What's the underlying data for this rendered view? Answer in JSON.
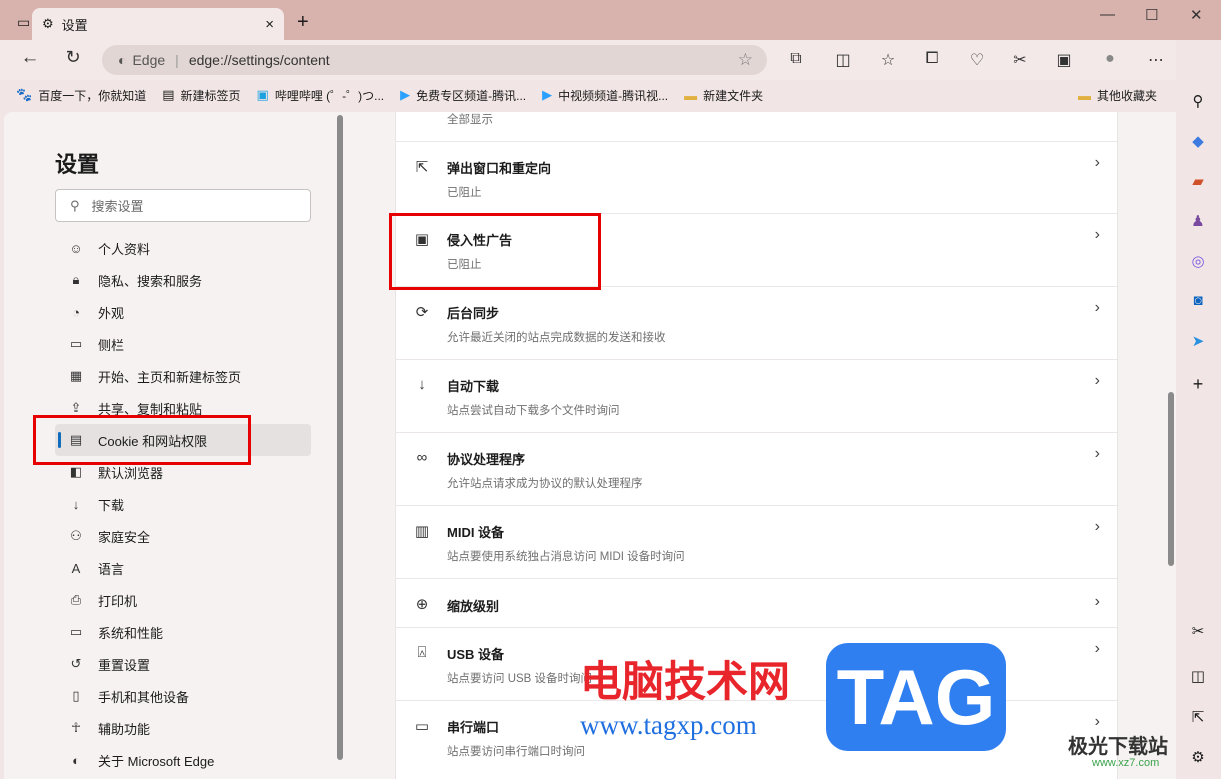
{
  "browser": {
    "tab_title": "设置",
    "address_brand": "Edge",
    "url": "edge://settings/content"
  },
  "bookmarks": [
    {
      "label": "百度一下，你就知道",
      "icon": "baidu-icon"
    },
    {
      "label": "新建标签页",
      "icon": "newtab-icon"
    },
    {
      "label": "哔哩哔哩 (゜-゜)つ...",
      "icon": "bilibili-icon"
    },
    {
      "label": "免费专区频道-腾讯...",
      "icon": "tencent-video-icon"
    },
    {
      "label": "中视频频道-腾讯视...",
      "icon": "tencent-video-icon"
    },
    {
      "label": "新建文件夹",
      "icon": "folder-icon"
    }
  ],
  "other_bookmarks": "其他收藏夹",
  "settings": {
    "title": "设置",
    "search_placeholder": "搜索设置",
    "nav": [
      {
        "label": "个人资料",
        "icon": "profile-icon"
      },
      {
        "label": "隐私、搜索和服务",
        "icon": "lock-icon"
      },
      {
        "label": "外观",
        "icon": "palette-icon"
      },
      {
        "label": "侧栏",
        "icon": "sidebar-icon"
      },
      {
        "label": "开始、主页和新建标签页",
        "icon": "home-icon"
      },
      {
        "label": "共享、复制和粘贴",
        "icon": "share-icon"
      },
      {
        "label": "Cookie 和网站权限",
        "icon": "cookie-icon",
        "active": true
      },
      {
        "label": "默认浏览器",
        "icon": "browser-icon"
      },
      {
        "label": "下载",
        "icon": "download-icon"
      },
      {
        "label": "家庭安全",
        "icon": "family-icon"
      },
      {
        "label": "语言",
        "icon": "language-icon"
      },
      {
        "label": "打印机",
        "icon": "printer-icon"
      },
      {
        "label": "系统和性能",
        "icon": "system-icon"
      },
      {
        "label": "重置设置",
        "icon": "reset-icon"
      },
      {
        "label": "手机和其他设备",
        "icon": "phone-icon"
      },
      {
        "label": "辅助功能",
        "icon": "accessibility-icon"
      },
      {
        "label": "关于 Microsoft Edge",
        "icon": "edge-icon"
      }
    ]
  },
  "content": {
    "partial_row_sub": "全部显示",
    "rows": [
      {
        "title": "弹出窗口和重定向",
        "sub": "已阻止",
        "icon": "popup-icon"
      },
      {
        "title": "侵入性广告",
        "sub": "已阻止",
        "icon": "ads-icon"
      },
      {
        "title": "后台同步",
        "sub": "允许最近关闭的站点完成数据的发送和接收",
        "icon": "sync-icon"
      },
      {
        "title": "自动下载",
        "sub": "站点尝试自动下载多个文件时询问",
        "icon": "download-icon"
      },
      {
        "title": "协议处理程序",
        "sub": "允许站点请求成为协议的默认处理程序",
        "icon": "protocol-icon"
      },
      {
        "title": "MIDI 设备",
        "sub": "站点要使用系统独占消息访问 MIDI 设备时询问",
        "icon": "midi-icon"
      },
      {
        "title": "缩放级别",
        "sub": "",
        "icon": "zoom-icon"
      },
      {
        "title": "USB 设备",
        "sub": "站点要访问 USB 设备时询问",
        "icon": "usb-icon"
      },
      {
        "title": "串行端口",
        "sub": "站点要访问串行端口时询问",
        "icon": "serial-icon"
      }
    ]
  },
  "watermark": {
    "cn": "电脑技术网",
    "url": "www.tagxp.com",
    "tag": "TAG",
    "site": "极光下载站",
    "site_url": "www.xz7.com"
  }
}
